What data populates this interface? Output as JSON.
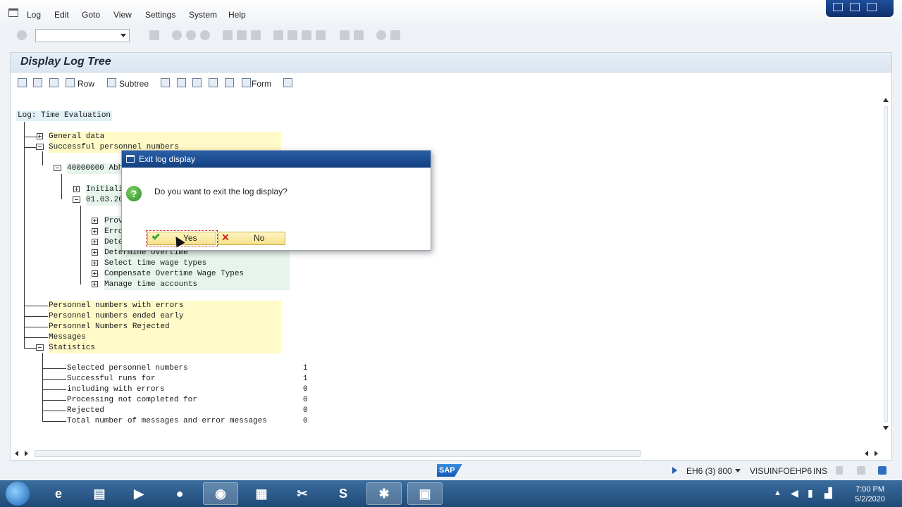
{
  "menu": {
    "items": [
      "Log",
      "Edit",
      "Goto",
      "View",
      "Settings",
      "System",
      "Help"
    ]
  },
  "screen": {
    "title": "Display Log Tree",
    "toolbar": {
      "row_label": "Row",
      "subtree_label": "Subtree",
      "form_label": "Form"
    }
  },
  "tree": {
    "root": "Log: Time Evaluation",
    "general": "General data",
    "successful": "Successful personnel numbers",
    "pernr": "40000000 Abhi",
    "initial": "Initiali",
    "date": "01.03.20",
    "steps": [
      "Prov",
      "Erro",
      "Dete",
      "Determine overtime",
      "Select time wage types",
      "Compensate Overtime Wage Types",
      "Manage time accounts"
    ],
    "errors": "Personnel numbers with errors",
    "ended_early": "Personnel numbers ended early",
    "rejected_top": "Personnel Numbers Rejected",
    "messages": "Messages",
    "statistics": "Statistics",
    "stats": [
      {
        "label": "Selected personnel numbers",
        "value": "1"
      },
      {
        "label": "Successful runs for",
        "value": "1"
      },
      {
        "label": "including with errors",
        "value": "0"
      },
      {
        "label": "Processing not completed for",
        "value": "0"
      },
      {
        "label": "Rejected",
        "value": "0"
      },
      {
        "label": "Total number of messages and error messages",
        "value": "0"
      }
    ]
  },
  "dialog": {
    "title": "Exit log display",
    "message": "Do you want to exit the log display?",
    "yes": "Yes",
    "no": "No"
  },
  "status": {
    "system": "EH6 (3) 800",
    "server": "VISUINFOEHP6",
    "mode": "INS",
    "logo": "SAP"
  },
  "taskbar": {
    "time": "7:00 PM",
    "date": "5/2/2020"
  }
}
